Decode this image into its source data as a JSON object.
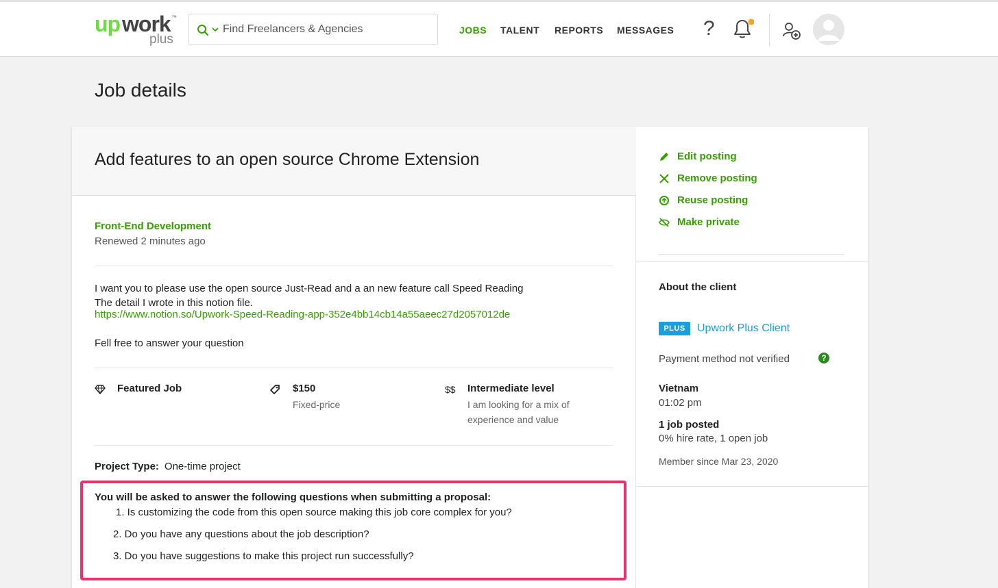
{
  "header": {
    "logo_up": "up",
    "logo_work": "work",
    "logo_tm": "™",
    "logo_plus": "plus",
    "search_placeholder": "Find Freelancers & Agencies",
    "nav": [
      {
        "label": "JOBS",
        "active": true
      },
      {
        "label": "TALENT",
        "active": false
      },
      {
        "label": "REPORTS",
        "active": false
      },
      {
        "label": "MESSAGES",
        "active": false
      }
    ],
    "help_label": "?",
    "notification_dot_color": "#f5a623"
  },
  "page_title": "Job details",
  "job": {
    "title": "Add features to an open source Chrome Extension",
    "category": "Front-End Development",
    "renewed": "Renewed 2 minutes ago",
    "description_line1": "I want you to please use the open source Just-Read and a an new feature call Speed Reading",
    "description_line2": "The detail I wrote in this notion file.",
    "description_link": "https://www.notion.so/Upwork-Speed-Reading-app-352e4bb14cb14a55aeec27d2057012de",
    "description_line3": "Fell free to answer your question",
    "features": {
      "featured": {
        "title": "Featured Job"
      },
      "price": {
        "title": "$150",
        "sub": "Fixed-price"
      },
      "level": {
        "symbol": "$$",
        "title": "Intermediate level",
        "sub_line1": "I am looking for a mix of",
        "sub_line2": "experience and value"
      }
    },
    "project_type_label": "Project Type:",
    "project_type_value": "One-time project",
    "questions_heading": "You will be asked to answer the following questions when submitting a proposal:",
    "questions": [
      "1. Is customizing the code from this open source making this job core complex for you?",
      "2. Do you have any questions about the job description?",
      "3. Do you have suggestions to make this project run successfully?"
    ]
  },
  "sidebar": {
    "actions": [
      {
        "label": "Edit posting",
        "icon": "pencil-icon"
      },
      {
        "label": "Remove posting",
        "icon": "close-icon"
      },
      {
        "label": "Reuse posting",
        "icon": "reuse-icon"
      },
      {
        "label": "Make private",
        "icon": "private-icon"
      }
    ],
    "about_heading": "About the client",
    "plus_badge": "PLUS",
    "plus_client": "Upwork Plus Client",
    "payment": "Payment method not verified",
    "help_dot": "?",
    "country": "Vietnam",
    "time": "01:02 pm",
    "jobs_posted": "1 job posted",
    "hire_rate": "0% hire rate, 1 open job",
    "member_since": "Member since Mar 23, 2020"
  },
  "colors": {
    "accent_green": "#37a000",
    "plus_blue": "#1d9ed9",
    "highlight_pink": "#f0306d"
  }
}
